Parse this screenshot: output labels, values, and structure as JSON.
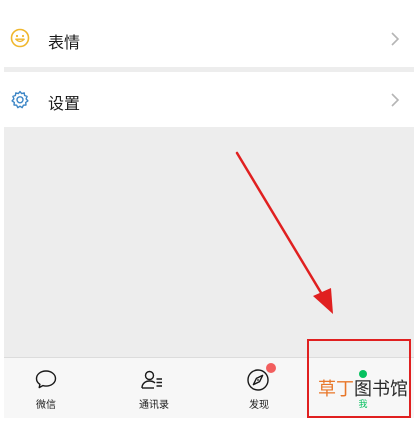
{
  "menu": {
    "items": [
      {
        "label": "表情",
        "icon": "emoji-icon",
        "accent": "#f0b72d"
      },
      {
        "label": "设置",
        "icon": "gear-icon",
        "accent": "#3d86c6"
      }
    ]
  },
  "tabbar": {
    "tabs": [
      {
        "label": "微信",
        "icon": "chat-bubble-icon"
      },
      {
        "label": "通讯录",
        "icon": "contacts-icon"
      },
      {
        "label": "发现",
        "icon": "compass-icon",
        "badge_color": "#f25e5e"
      },
      {
        "label": "我",
        "icon": "me-icon",
        "active": true,
        "active_color": "#07c160"
      }
    ]
  },
  "annotation": {
    "arrow_color": "#e02020",
    "box_color": "#e02020"
  },
  "watermark": {
    "text_part1": "草丁",
    "text_part2": "图书馆",
    "logo_text": "草丁图书馆"
  },
  "colors": {
    "background": "#ededed",
    "row": "#ffffff",
    "tabbar": "#f7f7f7",
    "active": "#07c160"
  }
}
